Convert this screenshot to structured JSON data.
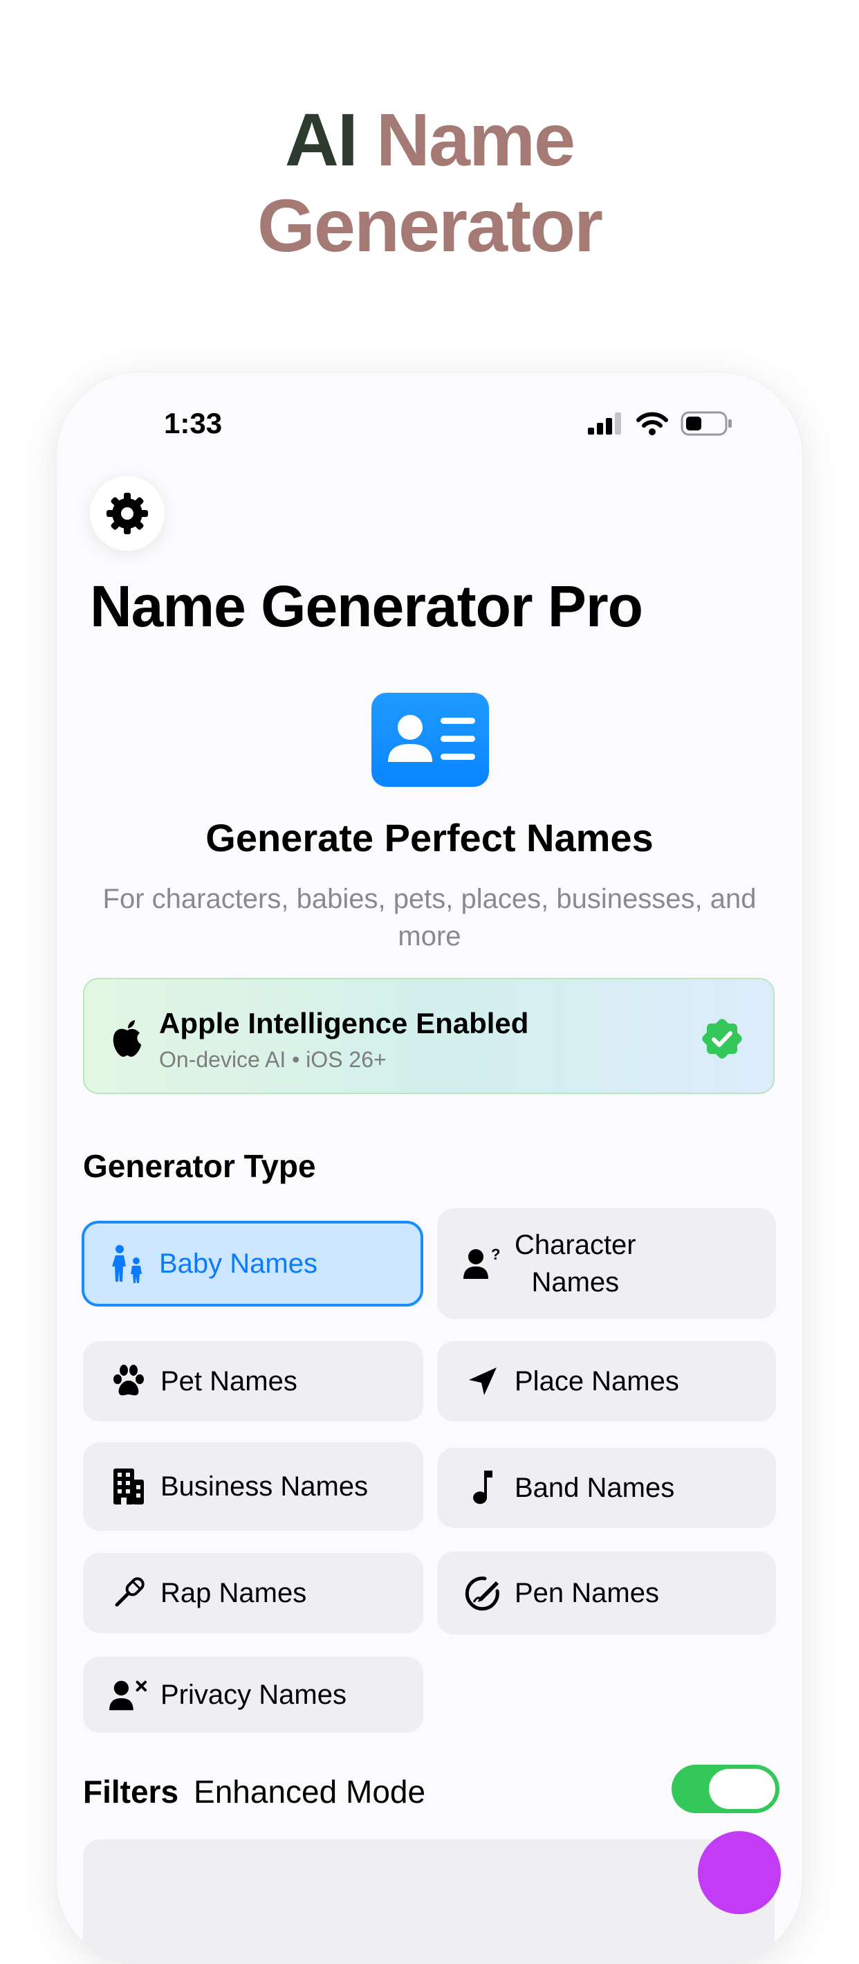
{
  "headline": {
    "part1": "AI",
    "part2": "Name",
    "line2": "Generator"
  },
  "colors": {
    "headline_dark": "#2d3a2e",
    "headline_accent": "#a57a74",
    "accent_blue": "#0a84ff",
    "toggle_on": "#34c759",
    "fab": "#c23bf5"
  },
  "status_bar": {
    "time": "1:33",
    "icons": [
      "signal-icon",
      "wifi-icon",
      "battery-icon"
    ]
  },
  "settings": {
    "icon": "gear-icon"
  },
  "app_title": "Name Generator Pro",
  "hero": {
    "icon": "contact-card-icon",
    "title": "Generate Perfect Names",
    "subtitle": "For characters, babies, pets, places, businesses, and more"
  },
  "ai_card": {
    "icon": "apple-logo-icon",
    "title": "Apple Intelligence Enabled",
    "subtitle": "On-device AI • iOS 26+",
    "badge_icon": "checkmark-seal-icon"
  },
  "generator": {
    "section_title": "Generator Type",
    "selected": "Baby Names",
    "types": [
      {
        "label": "Baby Names",
        "icon": "figure-child-icon"
      },
      {
        "label": "Character Names",
        "label_line1": "Character",
        "label_line2": "Names",
        "icon": "person-question-icon"
      },
      {
        "label": "Pet Names",
        "icon": "paw-icon"
      },
      {
        "label": "Place Names",
        "icon": "location-arrow-icon"
      },
      {
        "label": "Business Names",
        "icon": "building-icon"
      },
      {
        "label": "Band Names",
        "icon": "music-note-icon"
      },
      {
        "label": "Rap Names",
        "icon": "microphone-icon"
      },
      {
        "label": "Pen Names",
        "icon": "signature-icon"
      },
      {
        "label": "Privacy Names",
        "icon": "person-x-icon"
      }
    ]
  },
  "filters": {
    "title": "Filters",
    "enhanced_mode_label": "Enhanced Mode",
    "enhanced_mode_on": true
  }
}
